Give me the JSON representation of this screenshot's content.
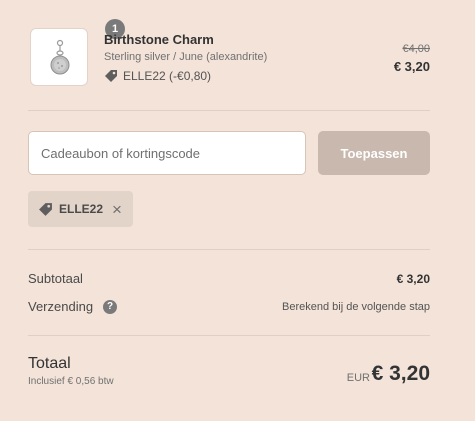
{
  "line_item": {
    "quantity": "1",
    "name": "Birthstone Charm",
    "variant": "Sterling silver / June (alexandrite)",
    "discount": "ELLE22 (-€0,80)",
    "original_price": "€4,00",
    "final_price": "€ 3,20",
    "image_icon": "silver-charm-pendant-icon"
  },
  "discount_form": {
    "placeholder": "Cadeaubon of kortingscode",
    "apply_label": "Toepassen",
    "applied_code": "ELLE22",
    "remove_icon": "×"
  },
  "totals": {
    "subtotal_label": "Subtotaal",
    "subtotal_value": "€ 3,20",
    "shipping_label": "Verzending",
    "shipping_help_icon": "?",
    "shipping_value": "Berekend bij de volgende stap",
    "total_label": "Totaal",
    "tax_note": "Inclusief € 0,56 btw",
    "currency": "EUR",
    "total_value": "€ 3,20"
  },
  "colors": {
    "background": "#f3e3d9",
    "button_disabled": "#c8b8ae",
    "badge": "#7a7a7a"
  }
}
